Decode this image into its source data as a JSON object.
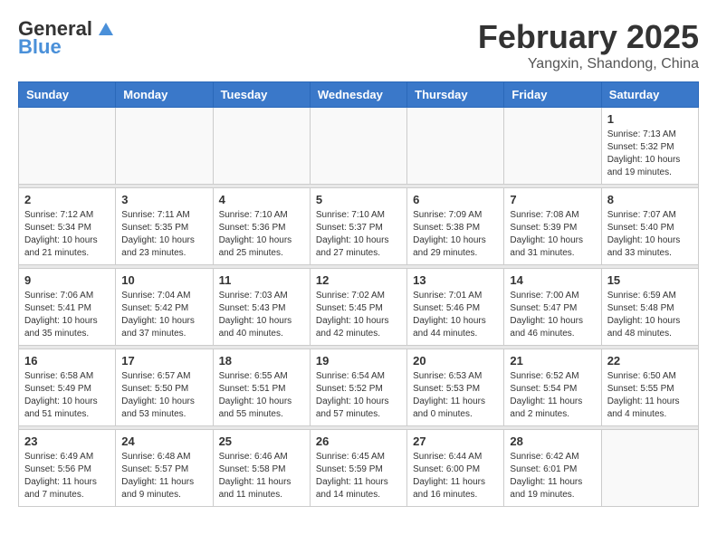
{
  "logo": {
    "line1": "General",
    "line2": "Blue"
  },
  "title": "February 2025",
  "location": "Yangxin, Shandong, China",
  "weekdays": [
    "Sunday",
    "Monday",
    "Tuesday",
    "Wednesday",
    "Thursday",
    "Friday",
    "Saturday"
  ],
  "weeks": [
    [
      {
        "day": "",
        "info": ""
      },
      {
        "day": "",
        "info": ""
      },
      {
        "day": "",
        "info": ""
      },
      {
        "day": "",
        "info": ""
      },
      {
        "day": "",
        "info": ""
      },
      {
        "day": "",
        "info": ""
      },
      {
        "day": "1",
        "info": "Sunrise: 7:13 AM\nSunset: 5:32 PM\nDaylight: 10 hours\nand 19 minutes."
      }
    ],
    [
      {
        "day": "2",
        "info": "Sunrise: 7:12 AM\nSunset: 5:34 PM\nDaylight: 10 hours\nand 21 minutes."
      },
      {
        "day": "3",
        "info": "Sunrise: 7:11 AM\nSunset: 5:35 PM\nDaylight: 10 hours\nand 23 minutes."
      },
      {
        "day": "4",
        "info": "Sunrise: 7:10 AM\nSunset: 5:36 PM\nDaylight: 10 hours\nand 25 minutes."
      },
      {
        "day": "5",
        "info": "Sunrise: 7:10 AM\nSunset: 5:37 PM\nDaylight: 10 hours\nand 27 minutes."
      },
      {
        "day": "6",
        "info": "Sunrise: 7:09 AM\nSunset: 5:38 PM\nDaylight: 10 hours\nand 29 minutes."
      },
      {
        "day": "7",
        "info": "Sunrise: 7:08 AM\nSunset: 5:39 PM\nDaylight: 10 hours\nand 31 minutes."
      },
      {
        "day": "8",
        "info": "Sunrise: 7:07 AM\nSunset: 5:40 PM\nDaylight: 10 hours\nand 33 minutes."
      }
    ],
    [
      {
        "day": "9",
        "info": "Sunrise: 7:06 AM\nSunset: 5:41 PM\nDaylight: 10 hours\nand 35 minutes."
      },
      {
        "day": "10",
        "info": "Sunrise: 7:04 AM\nSunset: 5:42 PM\nDaylight: 10 hours\nand 37 minutes."
      },
      {
        "day": "11",
        "info": "Sunrise: 7:03 AM\nSunset: 5:43 PM\nDaylight: 10 hours\nand 40 minutes."
      },
      {
        "day": "12",
        "info": "Sunrise: 7:02 AM\nSunset: 5:45 PM\nDaylight: 10 hours\nand 42 minutes."
      },
      {
        "day": "13",
        "info": "Sunrise: 7:01 AM\nSunset: 5:46 PM\nDaylight: 10 hours\nand 44 minutes."
      },
      {
        "day": "14",
        "info": "Sunrise: 7:00 AM\nSunset: 5:47 PM\nDaylight: 10 hours\nand 46 minutes."
      },
      {
        "day": "15",
        "info": "Sunrise: 6:59 AM\nSunset: 5:48 PM\nDaylight: 10 hours\nand 48 minutes."
      }
    ],
    [
      {
        "day": "16",
        "info": "Sunrise: 6:58 AM\nSunset: 5:49 PM\nDaylight: 10 hours\nand 51 minutes."
      },
      {
        "day": "17",
        "info": "Sunrise: 6:57 AM\nSunset: 5:50 PM\nDaylight: 10 hours\nand 53 minutes."
      },
      {
        "day": "18",
        "info": "Sunrise: 6:55 AM\nSunset: 5:51 PM\nDaylight: 10 hours\nand 55 minutes."
      },
      {
        "day": "19",
        "info": "Sunrise: 6:54 AM\nSunset: 5:52 PM\nDaylight: 10 hours\nand 57 minutes."
      },
      {
        "day": "20",
        "info": "Sunrise: 6:53 AM\nSunset: 5:53 PM\nDaylight: 11 hours\nand 0 minutes."
      },
      {
        "day": "21",
        "info": "Sunrise: 6:52 AM\nSunset: 5:54 PM\nDaylight: 11 hours\nand 2 minutes."
      },
      {
        "day": "22",
        "info": "Sunrise: 6:50 AM\nSunset: 5:55 PM\nDaylight: 11 hours\nand 4 minutes."
      }
    ],
    [
      {
        "day": "23",
        "info": "Sunrise: 6:49 AM\nSunset: 5:56 PM\nDaylight: 11 hours\nand 7 minutes."
      },
      {
        "day": "24",
        "info": "Sunrise: 6:48 AM\nSunset: 5:57 PM\nDaylight: 11 hours\nand 9 minutes."
      },
      {
        "day": "25",
        "info": "Sunrise: 6:46 AM\nSunset: 5:58 PM\nDaylight: 11 hours\nand 11 minutes."
      },
      {
        "day": "26",
        "info": "Sunrise: 6:45 AM\nSunset: 5:59 PM\nDaylight: 11 hours\nand 14 minutes."
      },
      {
        "day": "27",
        "info": "Sunrise: 6:44 AM\nSunset: 6:00 PM\nDaylight: 11 hours\nand 16 minutes."
      },
      {
        "day": "28",
        "info": "Sunrise: 6:42 AM\nSunset: 6:01 PM\nDaylight: 11 hours\nand 19 minutes."
      },
      {
        "day": "",
        "info": ""
      }
    ]
  ]
}
